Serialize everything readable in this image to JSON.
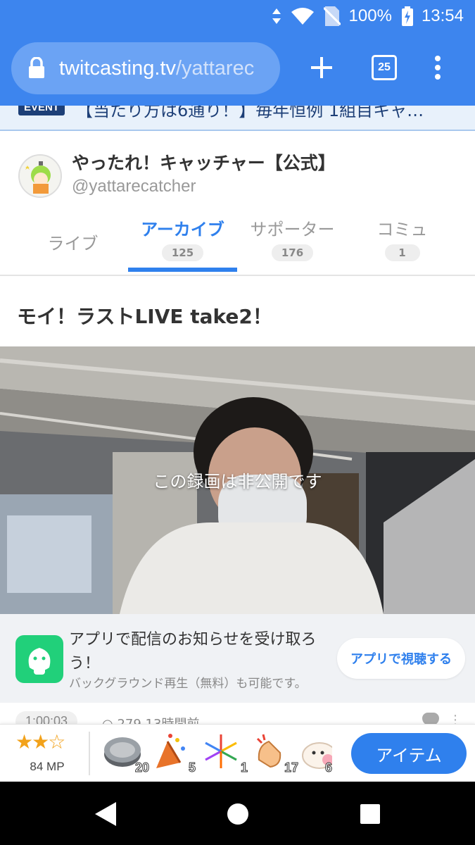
{
  "status_bar": {
    "battery": "100%",
    "time": "13:54"
  },
  "browser": {
    "url_host": "twitcasting.tv",
    "url_path": "/yattarec",
    "tab_count": "25"
  },
  "event": {
    "badge": "EVENT",
    "text": "【当たり方は6通り！】毎年恒例 1組目キャ…"
  },
  "channel": {
    "name": "やったれ！キャッチャー【公式】",
    "handle": "@yattarecatcher"
  },
  "tabs": [
    {
      "label": "ライブ",
      "count": ""
    },
    {
      "label": "アーカイブ",
      "count": "125"
    },
    {
      "label": "サポーター",
      "count": "176"
    },
    {
      "label": "コミュ",
      "count": "1"
    }
  ],
  "video": {
    "title": "モイ！ラストLIVE take2！",
    "overlay": "この録画は非公開です"
  },
  "promo": {
    "line1": "アプリで配信のお知らせを受け取ろ",
    "line2": "う！",
    "line3": "バックグラウンド再生（無料）も可能です。",
    "button": "アプリで視聴する"
  },
  "meta": {
    "duration": "1:00:03",
    "viewers": "279",
    "time_ago": "13時間前"
  },
  "item_bar": {
    "stars": "★★☆",
    "mp": "84 MP",
    "gifts": [
      {
        "icon": "coin-icon",
        "count": "20"
      },
      {
        "icon": "party-popper-icon",
        "count": "5"
      },
      {
        "icon": "fireworks-icon",
        "count": "1"
      },
      {
        "icon": "clapping-hands-icon",
        "count": "17"
      },
      {
        "icon": "mochi-icon",
        "count": "6"
      }
    ],
    "button": "アイテム"
  },
  "colors": {
    "brand_blue": "#3d85ee",
    "accent_blue": "#2f80ed",
    "app_green": "#21d07a",
    "star_orange": "#f2a21b"
  }
}
